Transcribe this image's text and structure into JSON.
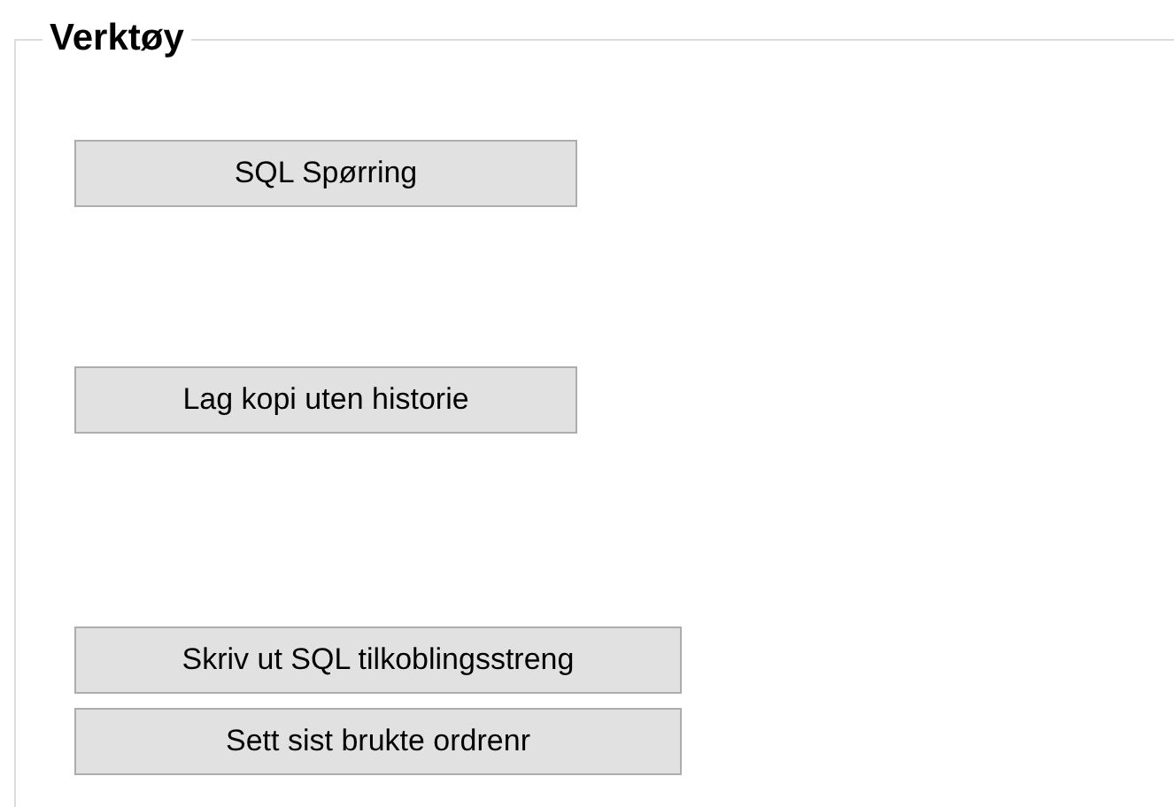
{
  "group": {
    "title": "Verktøy"
  },
  "buttons": [
    {
      "label": "SQL Spørring"
    },
    {
      "label": "Lag kopi uten historie"
    },
    {
      "label": "Skriv ut SQL tilkoblingsstreng"
    },
    {
      "label": "Sett sist brukte ordrenr"
    }
  ]
}
